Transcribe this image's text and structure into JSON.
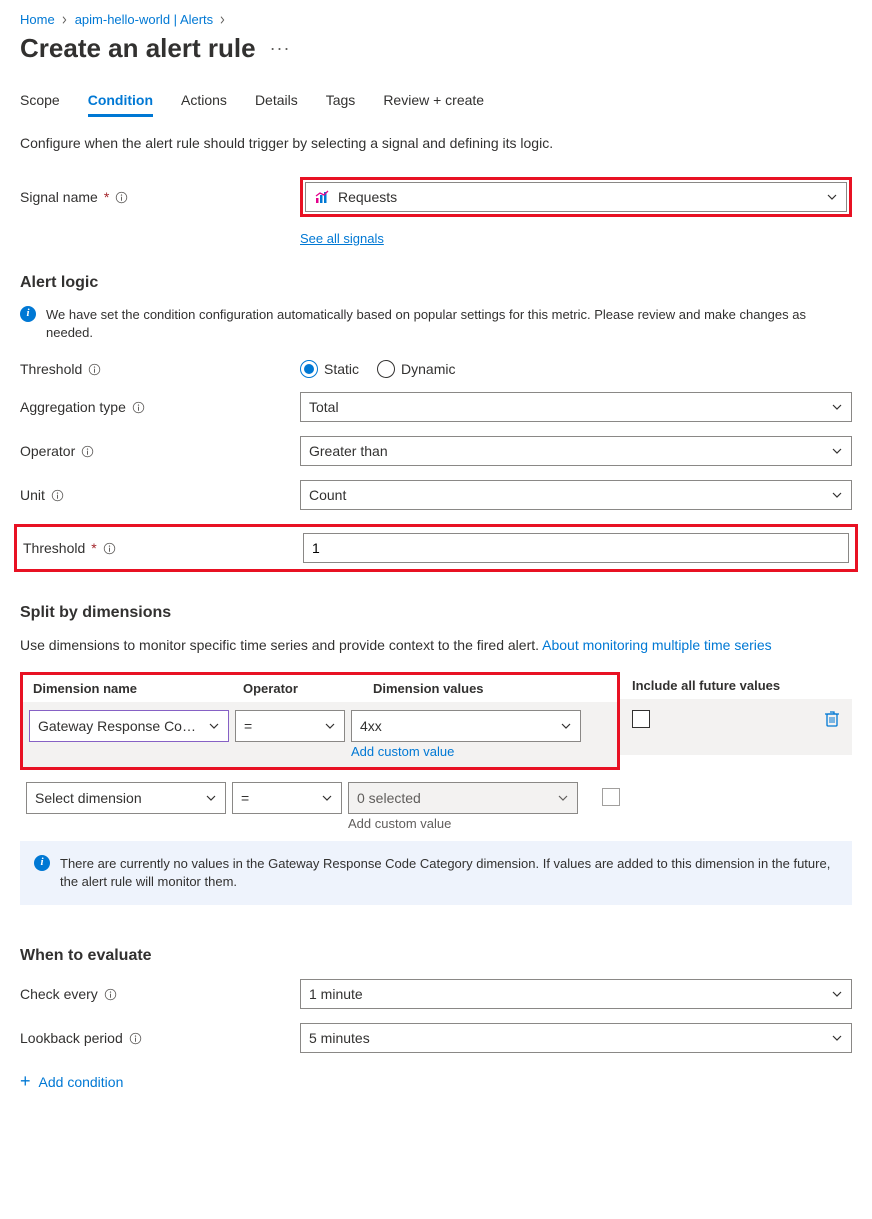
{
  "breadcrumb": {
    "home": "Home",
    "item1": "apim-hello-world | Alerts"
  },
  "page_title": "Create an alert rule",
  "tabs": {
    "scope": "Scope",
    "condition": "Condition",
    "actions": "Actions",
    "details": "Details",
    "tags": "Tags",
    "review": "Review + create"
  },
  "intro": "Configure when the alert rule should trigger by selecting a signal and defining its logic.",
  "signal": {
    "label": "Signal name",
    "value": "Requests",
    "see_all": "See all signals"
  },
  "alert_logic": {
    "heading": "Alert logic",
    "banner": "We have set the condition configuration automatically based on popular settings for this metric. Please review and make changes as needed.",
    "threshold_label": "Threshold",
    "threshold_static": "Static",
    "threshold_dynamic": "Dynamic",
    "agg_label": "Aggregation type",
    "agg_value": "Total",
    "op_label": "Operator",
    "op_value": "Greater than",
    "unit_label": "Unit",
    "unit_value": "Count",
    "threshold_value_label": "Threshold",
    "threshold_value": "1"
  },
  "dimensions": {
    "heading": "Split by dimensions",
    "desc_pre": "Use dimensions to monitor specific time series and provide context to the fired alert. ",
    "desc_link": "About monitoring multiple time series",
    "col_name": "Dimension name",
    "col_op": "Operator",
    "col_val": "Dimension values",
    "col_future": "Include all future values",
    "row1_name": "Gateway Response Co…",
    "row1_op": "=",
    "row1_val": "4xx",
    "add_custom": "Add custom value",
    "row2_name": "Select dimension",
    "row2_op": "=",
    "row2_val_placeholder": "0 selected",
    "banner2": "There are currently no values in the Gateway Response Code Category dimension. If values are added to this dimension in the future, the alert rule will monitor them."
  },
  "evaluate": {
    "heading": "When to evaluate",
    "check_label": "Check every",
    "check_value": "1 minute",
    "lookback_label": "Lookback period",
    "lookback_value": "5 minutes"
  },
  "add_condition": "Add condition"
}
